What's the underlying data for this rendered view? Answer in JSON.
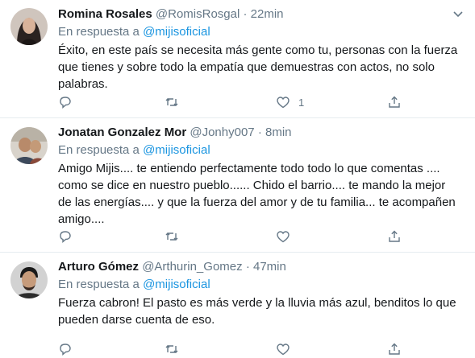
{
  "tweets": [
    {
      "name": "Romina Rosales",
      "handle": "@RomisRosgal",
      "time": "22min",
      "reply_prefix": "En respuesta a",
      "reply_to": "@mijisoficial",
      "text_lines": [
        "Éxito, en este país se necesita más gente como tu, personas con la fuerza",
        "que tienes y sobre todo la empatía que demuestras con actos, no solo",
        "palabras."
      ],
      "like_count": "1"
    },
    {
      "name": "Jonatan Gonzalez Mor",
      "handle": "@Jonhy007",
      "time": "8min",
      "reply_prefix": "En respuesta a",
      "reply_to": "@mijisoficial",
      "text_lines": [
        "Amigo Mijis.... te entiendo perfectamente todo todo lo que comentas ....",
        "como se dice en nuestro pueblo...... Chido el barrio.... te mando la mejor",
        "de las energías.... y que la fuerza del amor y de tu familia... te acompañen",
        "amigo...."
      ],
      "like_count": ""
    },
    {
      "name": "Arturo Gómez",
      "handle": "@Arthurin_Gomez",
      "time": "47min",
      "reply_prefix": "En respuesta a",
      "reply_to": "@mijisoficial",
      "text_lines": [
        "Fuerza cabron! El pasto es más verde y la lluvia más azul, benditos lo que",
        "pueden darse cuenta de eso."
      ],
      "like_count": ""
    }
  ],
  "separator": "·",
  "icons": {
    "caret": "chevron-down-icon",
    "reply": "reply-icon",
    "retweet": "retweet-icon",
    "like": "heart-icon",
    "share": "share-icon"
  },
  "colors": {
    "name": "#14171a",
    "meta": "#657786",
    "mention": "#1b95e0",
    "divider": "#e6ecf0"
  }
}
